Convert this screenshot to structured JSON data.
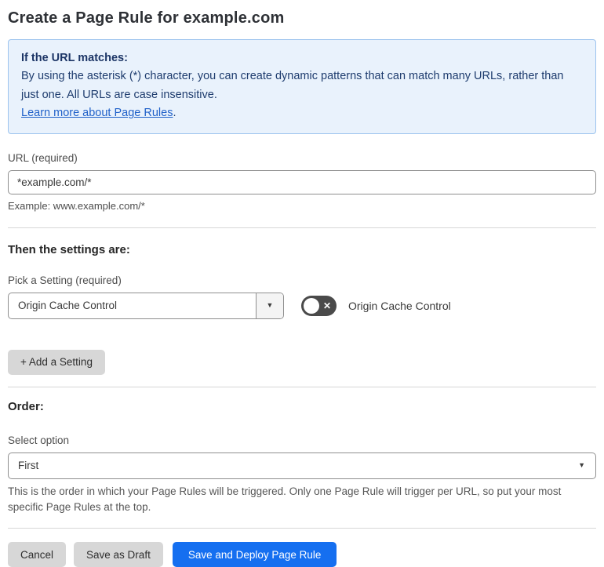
{
  "page": {
    "title": "Create a Page Rule for example.com"
  },
  "info_box": {
    "heading": "If the URL matches:",
    "body": "By using the asterisk (*) character, you can create dynamic patterns that can match many URLs, rather than just one. All URLs are case insensitive.",
    "link": "Learn more about Page Rules",
    "link_suffix": "."
  },
  "url_section": {
    "label": "URL (required)",
    "value": "*example.com/*",
    "example": "Example: www.example.com/*"
  },
  "settings_section": {
    "heading": "Then the settings are:",
    "picker_label": "Pick a Setting (required)",
    "picker_value": "Origin Cache Control",
    "toggle_label": "Origin Cache Control",
    "toggle_state": "off",
    "add_setting_button": "+ Add a Setting"
  },
  "order_section": {
    "heading": "Order:",
    "select_label": "Select option",
    "select_value": "First",
    "help": "This is the order in which your Page Rules will be triggered. Only one Page Rule will trigger per URL, so put your most specific Page Rules at the top."
  },
  "footer": {
    "cancel": "Cancel",
    "save_draft": "Save as Draft",
    "save_deploy": "Save and Deploy Page Rule"
  },
  "icons": {
    "caret_down": "▼",
    "toggle_off_x": "✕"
  },
  "colors": {
    "accent_blue": "#156ff0",
    "info_bg": "#e9f2fc",
    "info_border": "#9cc3ee",
    "info_text": "#1e3c6e",
    "link_blue": "#2061c9",
    "toggle_off": "#4a4a4a",
    "button_gray": "#d7d7d7"
  }
}
